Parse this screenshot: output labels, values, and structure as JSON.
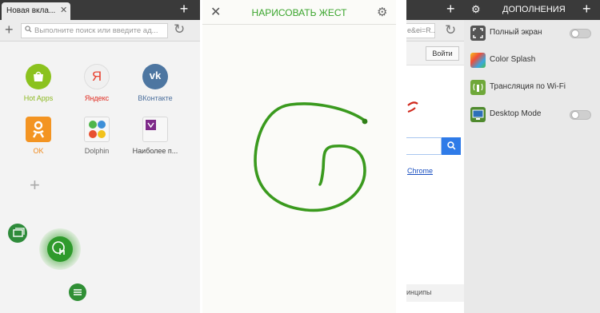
{
  "panel1": {
    "tab_title": "Новая вкла...",
    "tab_close": "✕",
    "new_tab": "+",
    "url_plus": "+",
    "url_placeholder": "Выполните поиск или введите ад...",
    "reload": "↻",
    "speed_dial": [
      {
        "label": "Hot Apps",
        "label_color": "#8bb81e",
        "icon": "hot-apps-icon",
        "icon_color": "#8bc21e"
      },
      {
        "label": "Яндекс",
        "label_color": "#e02b20",
        "icon": "yandex-icon",
        "icon_color": "#e94333",
        "icon_text": "Я"
      },
      {
        "label": "ВКонтакте",
        "label_color": "#4a6e9c",
        "icon": "vk-icon",
        "icon_color": "#4d76a1",
        "icon_text": "vk"
      },
      {
        "label": "OK",
        "label_color": "#f08a1d",
        "icon": "odnoklassniki-icon",
        "icon_color": "#f39422"
      },
      {
        "label": "Dolphin",
        "label_color": "#666666",
        "icon": "dolphin-folder-icon"
      },
      {
        "label": "Наиболее п...",
        "label_color": "#444444",
        "icon": "most-visited-icon",
        "icon_color": "#7e2a8a"
      }
    ],
    "add_dial": "+"
  },
  "panel2": {
    "close": "✕",
    "title": "НАРИСОВАТЬ ЖЕСТ",
    "gear": "⚙"
  },
  "panel3": {
    "plus": "+",
    "url_text": "e&ei=R...",
    "reload": "↻",
    "login_button": "Войти",
    "search_icon": "🔍",
    "link_text": "Chrome",
    "footer_text": "инципы"
  },
  "panel4": {
    "gear": "⚙",
    "title": "ДОПОЛНЕНИЯ",
    "plus": "+",
    "addons": [
      {
        "label": "Полный экран",
        "icon": "fullscreen-icon",
        "toggle": true,
        "toggle_on": false
      },
      {
        "label": "Color Splash",
        "icon": "color-splash-icon",
        "toggle": false
      },
      {
        "label": "Трансляция по Wi-Fi",
        "icon": "wifi-broadcast-icon",
        "toggle": false
      },
      {
        "label": "Desktop Mode",
        "icon": "desktop-mode-icon",
        "toggle": true,
        "toggle_on": false
      }
    ]
  },
  "colors": {
    "accent_green": "#3aa52c",
    "gesture_stroke": "#3a9a1e",
    "dark_bar": "#3a3a3a"
  }
}
